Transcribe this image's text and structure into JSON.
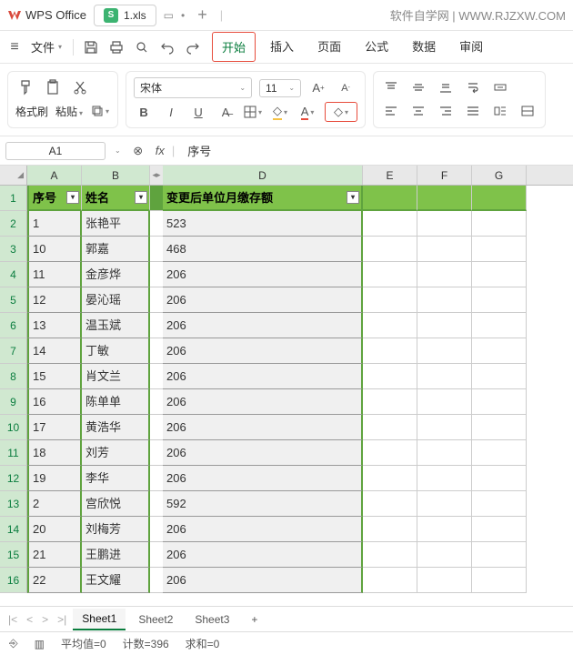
{
  "app": {
    "name": "WPS Office",
    "file_tab": "1.xls",
    "watermark": "软件自学网 | WWW.RJZXW.COM"
  },
  "menu": {
    "file": "文件",
    "items": [
      "开始",
      "插入",
      "页面",
      "公式",
      "数据",
      "审阅"
    ],
    "active_index": 0
  },
  "ribbon": {
    "brush": "格式刷",
    "paste": "粘贴",
    "font_name": "宋体",
    "font_size": "11"
  },
  "formula": {
    "name_box": "A1",
    "value": "序号"
  },
  "columns": [
    "A",
    "B",
    "D",
    "E",
    "F",
    "G"
  ],
  "headers": {
    "col1": "序号",
    "col2": "姓名",
    "col3": "变更后单位月缴存额"
  },
  "rows": [
    {
      "n": "1",
      "a": "1",
      "b": "张艳平",
      "d": "523"
    },
    {
      "n": "2",
      "a": "10",
      "b": "郭嘉",
      "d": "468"
    },
    {
      "n": "3",
      "a": "11",
      "b": "金彦烨",
      "d": "206"
    },
    {
      "n": "4",
      "a": "12",
      "b": "晏沁瑶",
      "d": "206"
    },
    {
      "n": "5",
      "a": "13",
      "b": "温玉斌",
      "d": "206"
    },
    {
      "n": "6",
      "a": "14",
      "b": "丁敏",
      "d": "206"
    },
    {
      "n": "7",
      "a": "15",
      "b": "肖文兰",
      "d": "206"
    },
    {
      "n": "8",
      "a": "16",
      "b": "陈单单",
      "d": "206"
    },
    {
      "n": "9",
      "a": "17",
      "b": "黄浩华",
      "d": "206"
    },
    {
      "n": "10",
      "a": "18",
      "b": "刘芳",
      "d": "206"
    },
    {
      "n": "11",
      "a": "19",
      "b": "李华",
      "d": "206"
    },
    {
      "n": "12",
      "a": "2",
      "b": "宫欣悦",
      "d": "592"
    },
    {
      "n": "13",
      "a": "20",
      "b": "刘梅芳",
      "d": "206"
    },
    {
      "n": "14",
      "a": "21",
      "b": "王鹏进",
      "d": "206"
    },
    {
      "n": "15",
      "a": "22",
      "b": "王文耀",
      "d": "206"
    }
  ],
  "sheets": {
    "names": [
      "Sheet1",
      "Sheet2",
      "Sheet3"
    ],
    "active_index": 0
  },
  "status": {
    "avg": "平均值=0",
    "count": "计数=396",
    "sum": "求和=0"
  },
  "chart_data": null
}
